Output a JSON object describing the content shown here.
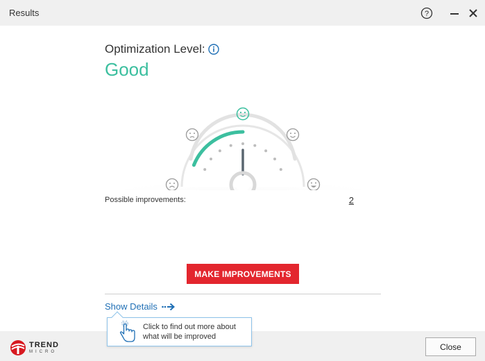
{
  "window": {
    "title": "Results",
    "help_icon": "question-circle-icon",
    "minimize_icon": "minimize-icon",
    "close_icon": "close-x-icon"
  },
  "optimization": {
    "label": "Optimization Level:",
    "info_icon": "info-circle-icon",
    "value": "Good",
    "value_color": "#3cbf9f"
  },
  "gauge": {
    "level": "Good",
    "faces": [
      "very-sad-face-icon",
      "sad-face-icon",
      "smile-face-icon",
      "happy-face-icon",
      "very-happy-face-icon"
    ],
    "active_face": "smile-face-icon",
    "fill_fraction": 0.5,
    "arc_color": "#3cbf9f"
  },
  "improvements": {
    "label": "Possible improvements:",
    "count": "2"
  },
  "actions": {
    "make_improvements": "MAKE IMPROVEMENTS",
    "make_improvements_color": "#e3262e",
    "show_details": "Show Details",
    "close": "Close"
  },
  "tooltip": {
    "line1": "Click to find out more about",
    "line2": "what will be improved",
    "icon": "pointing-hand-icon"
  },
  "brand": {
    "name_line1": "TREND",
    "name_line2": "MICRO",
    "logo_icon": "trend-micro-logo-icon",
    "color": "#d71920"
  }
}
